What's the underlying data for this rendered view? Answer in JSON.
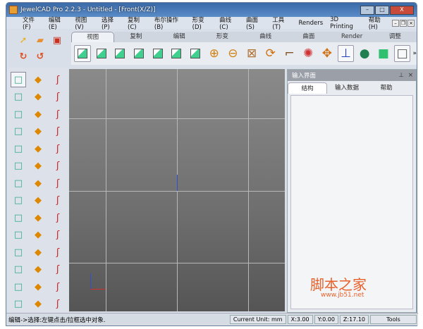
{
  "window": {
    "title": "JewelCAD Pro 2.2.3 - Untitled - [Front(X/Z)]",
    "minimize": "–",
    "maximize": "□",
    "close": "X"
  },
  "menu": [
    "文件(F)",
    "编辑(E)",
    "视图(V)",
    "选择(P)",
    "复制(C)",
    "布尔操作(B)",
    "形变(D)",
    "曲线(C)",
    "曲面(S)",
    "工具(T)",
    "Renders",
    "3D Printing",
    "帮助(H)"
  ],
  "mdi_buttons": [
    "–",
    "❐",
    "×"
  ],
  "ribbon_tabs": [
    "视图",
    "复制",
    "编辑",
    "形变",
    "曲线",
    "曲面",
    "Render",
    "调整"
  ],
  "active_tab": 0,
  "view_icons": [
    "view-iso",
    "view-front",
    "view-top",
    "view-back",
    "view-right",
    "view-left",
    "view-custom"
  ],
  "tool_icons": [
    "zoom-in",
    "zoom-out",
    "zoom-extents",
    "rotate-view",
    "pan-view",
    "render-light",
    "move-axis",
    "axis-display",
    "sphere-shade",
    "solid-shade",
    "wireframe-shade"
  ],
  "more_label": "»",
  "left_icons": [
    "select",
    "folder",
    "save",
    "redo",
    "undo"
  ],
  "panel": {
    "title": "输入界面",
    "pin": "⊥",
    "close": "×",
    "tabs": [
      "结构",
      "输入数据",
      "帮助"
    ]
  },
  "status": {
    "message": "编辑->选择:左键点击/拉框选中对象.",
    "unit_label": "Current Unit:",
    "unit": "mm",
    "x": "X:3.00",
    "y": "Y:0.00",
    "z": "Z:17.10",
    "tools": "Tools"
  },
  "watermark": {
    "text": "脚本之家",
    "url": "www.jb51.net"
  }
}
